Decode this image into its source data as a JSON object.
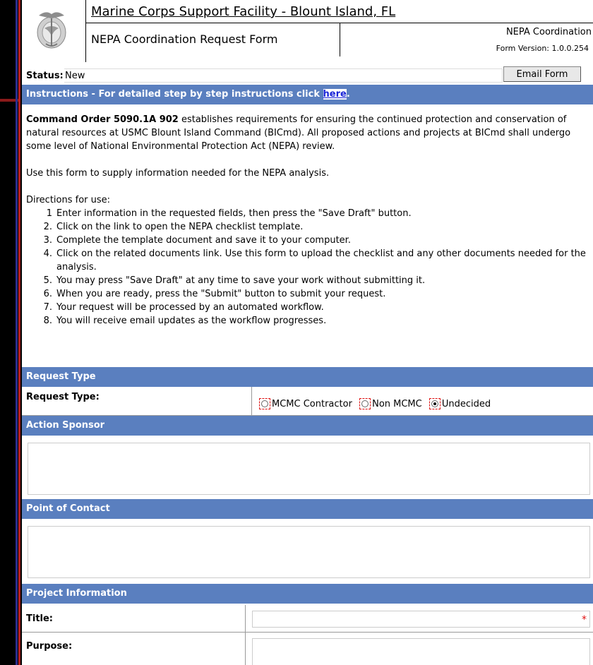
{
  "header": {
    "site_title": "Marine Corps Support Facility - Blount Island, FL",
    "form_title": "NEPA Coordination Request Form",
    "nepa_label": "NEPA Coordination",
    "form_version": "Form Version: 1.0.0.254"
  },
  "status": {
    "label": "Status:",
    "value": "New",
    "email_button": "Email Form"
  },
  "instructions": {
    "bar_text": "Instructions - For detailed step by step instructions click ",
    "bar_link": "here",
    "bar_tail": ".",
    "order_bold": "Command Order 5090.1A 902",
    "order_text": " establishes requirements for ensuring the continued protection and conservation of natural resources at USMC Blount Island Command (BICmd). All proposed actions and projects at BICmd shall undergo some level of National Environmental Protection Act (NEPA) review.",
    "use_text": "Use this form to supply information needed for the NEPA analysis.",
    "directions_label": "Directions for use:",
    "steps": [
      {
        "n": "1",
        "text": "Enter information in the requested fields, then press the \"Save Draft\" button."
      },
      {
        "n": "2.",
        "text": "Click on the link to open the NEPA checklist template."
      },
      {
        "n": "3.",
        "text": "Complete the template document and save it to your computer."
      },
      {
        "n": "4.",
        "text": "Click on the related documents link.  Use this form to upload the checklist and any other documents needed for the analysis."
      },
      {
        "n": "5.",
        "text": "You may press \"Save Draft\" at any time to save your work without submitting it."
      },
      {
        "n": "6.",
        "text": "When you are ready, press the \"Submit\" button to submit your request."
      },
      {
        "n": "7.",
        "text": "Your request will be processed by an automated workflow."
      },
      {
        "n": "8.",
        "text": "You will receive email updates as the workflow progresses."
      }
    ]
  },
  "request_type": {
    "section_title": "Request Type",
    "label": "Request Type:",
    "options": [
      "MCMC Contractor",
      "Non MCMC",
      "Undecided"
    ],
    "selected": "Undecided"
  },
  "action_sponsor": {
    "section_title": "Action Sponsor"
  },
  "point_of_contact": {
    "section_title": "Point of Contact"
  },
  "project_info": {
    "section_title": "Project Information",
    "title_label": "Title:",
    "purpose_label": "Purpose:",
    "required_mark": "*"
  },
  "colors": {
    "section_bar": "#5a7fbf",
    "required": "#e01010",
    "link": "#1a25d8"
  }
}
